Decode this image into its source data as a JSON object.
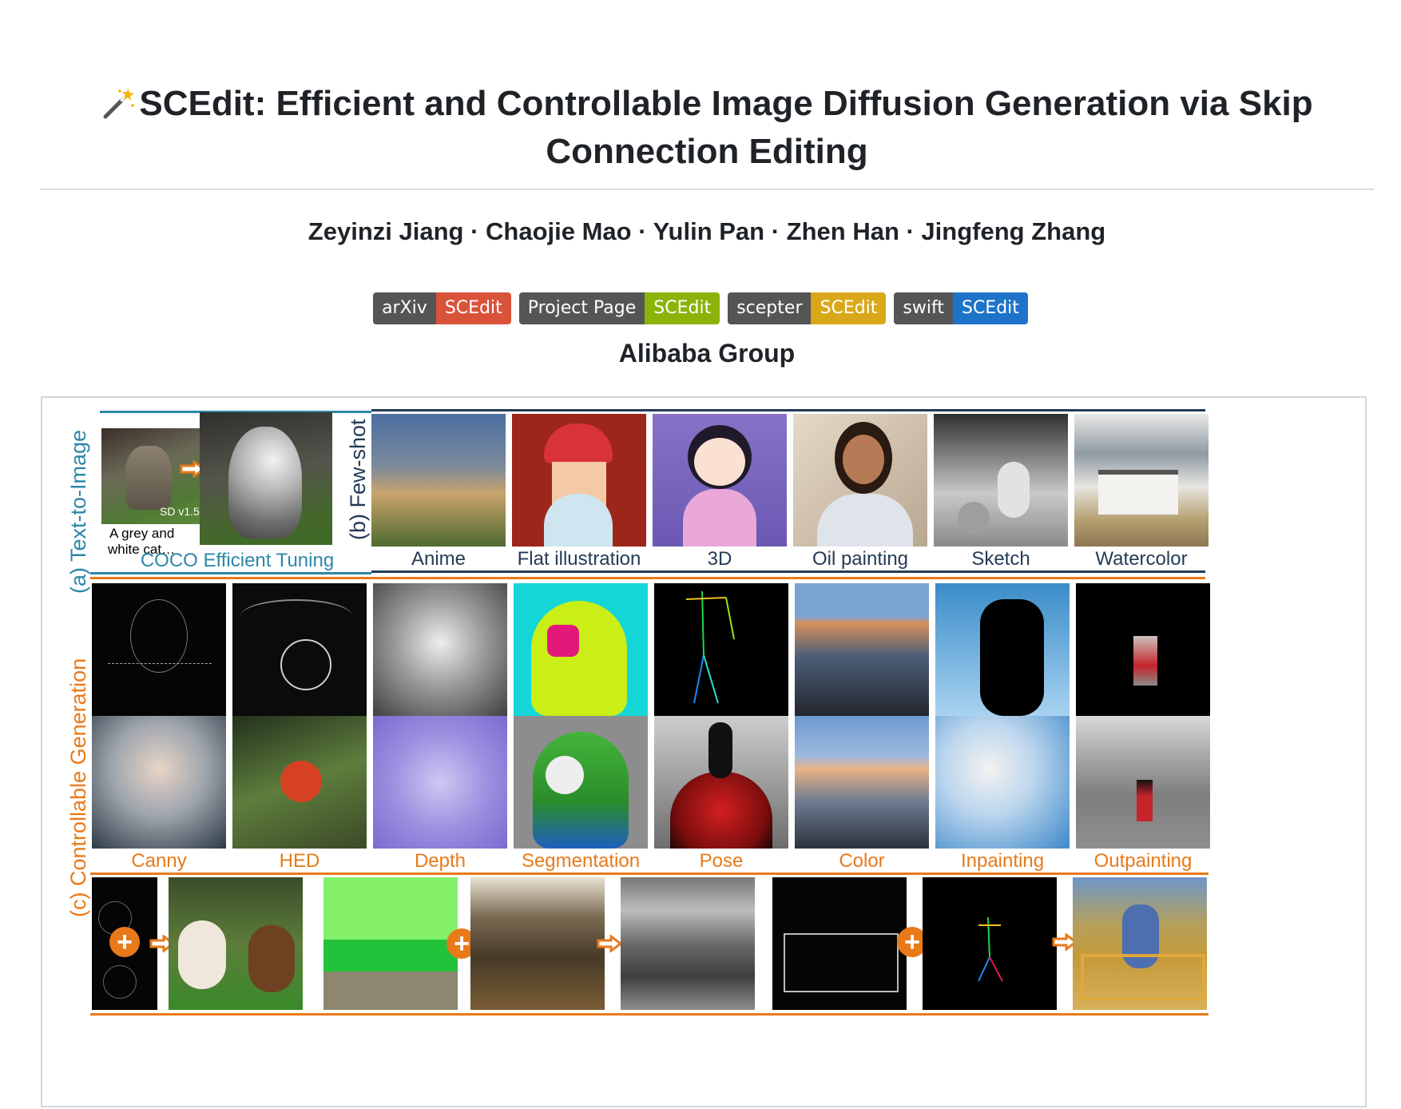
{
  "header": {
    "title": "SCEdit: Efficient and Controllable Image Diffusion Generation via Skip Connection Editing",
    "title_icon": "magic-wand-icon",
    "authors": "Zeyinzi Jiang · Chaojie Mao · Yulin Pan · Zhen Han · Jingfeng Zhang",
    "organization": "Alibaba Group"
  },
  "badges": [
    {
      "left": "arXiv",
      "right": "SCEdit",
      "color": "#d9533b"
    },
    {
      "left": "Project Page",
      "right": "SCEdit",
      "color": "#8bb30a"
    },
    {
      "left": "scepter",
      "right": "SCEdit",
      "color": "#d8a81a"
    },
    {
      "left": "swift",
      "right": "SCEdit",
      "color": "#1d74c8"
    }
  ],
  "figure": {
    "sections": {
      "text_to_image": "(a) Text-to-Image",
      "few_shot": "(b) Few-shot",
      "controllable": "(c) Controllable Generation"
    },
    "t2i": {
      "model_tag": "SD v1.5",
      "prompt_line1": "A grey and",
      "prompt_line2": "white cat…",
      "caption": "COCO Efficient Tuning"
    },
    "few_shot_styles": [
      "Anime",
      "Flat illustration",
      "3D",
      "Oil painting",
      "Sketch",
      "Watercolor"
    ],
    "control_types": [
      "Canny",
      "HED",
      "Depth",
      "Segmentation",
      "Pose",
      "Color",
      "Inpainting",
      "Outpainting"
    ],
    "colors": {
      "teal": "#2e86a8",
      "navy": "#243b55",
      "orange": "#e87a1a"
    }
  }
}
